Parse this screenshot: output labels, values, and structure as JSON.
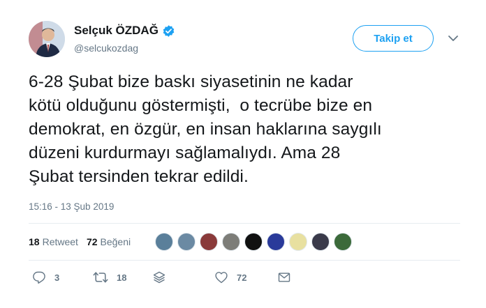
{
  "author": {
    "display_name": "Selçuk ÖZDAĞ",
    "handle": "@selcukozdag",
    "verified": true
  },
  "follow_button": {
    "label": "Takip et"
  },
  "tweet": {
    "text": "6-28 Şubat bize baskı siyasetinin ne kadar\nkötü olduğunu göstermişti,  o tecrübe bize en\ndemokrat, en özgür, en insan haklarına saygılı\ndüzeni kurdurmayı sağlamalıydı. Ama 28\nŞubat tersinden tekrar edildi.",
    "timestamp": "15:16 - 13 Şub 2019"
  },
  "stats": {
    "retweets_count": "18",
    "retweets_label": "Retweet",
    "likes_count": "72",
    "likes_label": "Beğeni"
  },
  "liker_avatars": [
    {
      "name": "liker-1",
      "color": "#5a7f9a"
    },
    {
      "name": "liker-2",
      "color": "#6b8aa3"
    },
    {
      "name": "liker-3",
      "color": "#8a3a3a"
    },
    {
      "name": "liker-4",
      "color": "#7d7d78"
    },
    {
      "name": "liker-5",
      "color": "#111111"
    },
    {
      "name": "liker-6",
      "color": "#2a3a9a"
    },
    {
      "name": "liker-7",
      "color": "#e8e0a0"
    },
    {
      "name": "liker-8",
      "color": "#3a3a4a"
    },
    {
      "name": "liker-9",
      "color": "#3c6a3a"
    }
  ],
  "actions": {
    "reply_count": "3",
    "retweet_count": "18",
    "like_count": "72",
    "icons": [
      "reply-icon",
      "retweet-icon",
      "layers-icon",
      "heart-icon",
      "mail-icon"
    ]
  },
  "colors": {
    "accent": "#1da1f2",
    "text": "#14171a",
    "muted": "#657786",
    "border": "#e6ecf0"
  }
}
